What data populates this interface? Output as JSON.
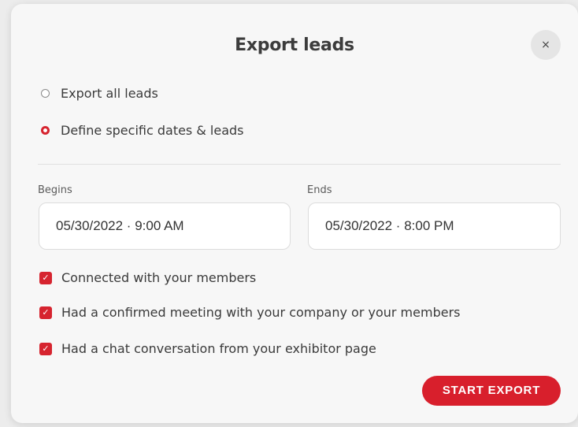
{
  "dialog": {
    "title": "Export leads",
    "close_glyph": "×"
  },
  "options": {
    "all": {
      "label": "Export all leads",
      "selected": false
    },
    "specific": {
      "label": "Define specific dates & leads",
      "selected": true
    }
  },
  "dates": {
    "begins_label": "Begins",
    "begins_value": "05/30/2022 · 9:00 AM",
    "ends_label": "Ends",
    "ends_value": "05/30/2022 · 8:00 PM"
  },
  "criteria": [
    {
      "label": "Connected with your members",
      "checked": true
    },
    {
      "label": "Had a confirmed meeting with your company or your members",
      "checked": true
    },
    {
      "label": "Had a chat conversation from your exhibitor page",
      "checked": true
    }
  ],
  "actions": {
    "start_export": "START EXPORT"
  },
  "colors": {
    "accent": "#d6242f",
    "background": "#f7f7f7"
  },
  "icons": {
    "close": "close-icon",
    "check": "check-icon"
  }
}
